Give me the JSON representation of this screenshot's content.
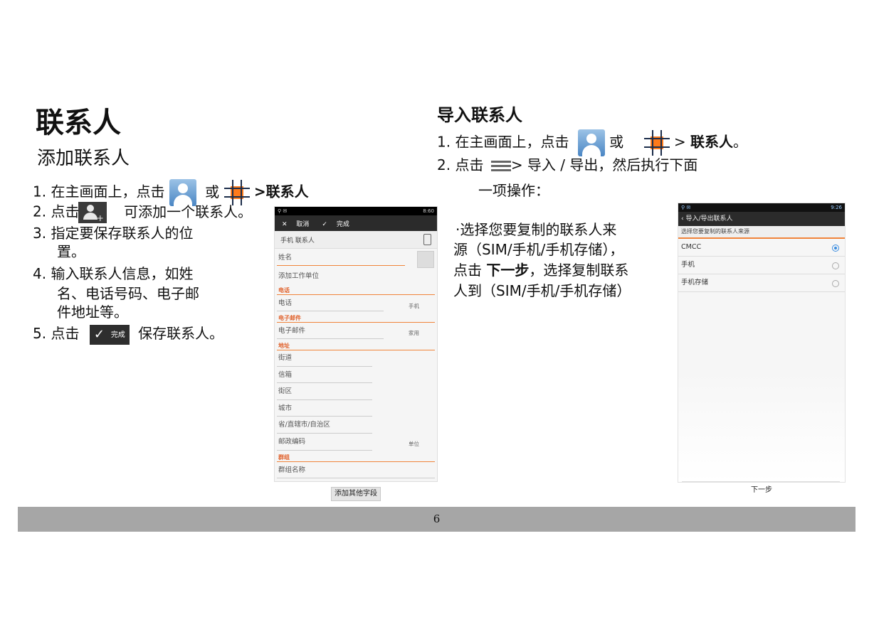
{
  "left": {
    "title": "联系人",
    "subtitle": "添加联系人",
    "step1_prefix": "1.  在主画面上，点击",
    "step1_or": "或",
    "step1_suffix": ">联系人",
    "step2_prefix": "2.  点击",
    "step2_suffix": "可添加一个联系人。",
    "step3_l1": "3.  指定要保存联系人的位",
    "step3_l2": "置。",
    "step4_l1": "4.  输入联系人信息，如姓",
    "step4_l2": "名、电话号码、电子邮",
    "step4_l3": "件地址等。",
    "step5_prefix": "5.  点击",
    "step5_suffix": "保存联系人。"
  },
  "icons": {
    "done_label": "完成"
  },
  "phone1": {
    "cancel": "取消",
    "done": "完成",
    "account": "手机 联系人",
    "name": "姓名",
    "company": "添加工作单位",
    "sec_phone": "电话",
    "phone": "电话",
    "phone_type": "手机",
    "sec_email": "电子邮件",
    "email": "电子邮件",
    "email_type": "家用",
    "sec_address": "地址",
    "street": "街道",
    "pobox": "信箱",
    "district": "街区",
    "city": "城市",
    "province": "省/直辖市/自治区",
    "postal": "邮政编码",
    "address_type": "单位",
    "sec_group": "群组",
    "group_name": "群组名称",
    "add_field": "添加其他字段",
    "time": "8:60"
  },
  "right": {
    "title": "导入联系人",
    "step1_prefix": "1.      在主画面上，点击",
    "step1_or": "或",
    "step1_suffix_pre": ">",
    "step1_suffix_bold": "联系人",
    "step1_end": "。",
    "step2_prefix": "2.      点击",
    "step2_suffix": "> 导入 / 导出，然后执行下面",
    "step2_l2": "一项操作：",
    "bullet_l1": "·选择您要复制的联系人来",
    "bullet_l2": "源（SIM/手机/手机存储），",
    "bullet_l3_pre": "点击 ",
    "bullet_l3_bold": "下一步",
    "bullet_l3_post": "，选择复制联系",
    "bullet_l4": "人到（SIM/手机/手机存储）"
  },
  "phone2": {
    "time": "9:26",
    "title": "导入/导出联系人",
    "subtitle": "选择您要复制的联系人来源",
    "options": [
      "CMCC",
      "手机",
      "手机存储"
    ],
    "next": "下一步"
  },
  "footer": {
    "page_number": "6"
  }
}
